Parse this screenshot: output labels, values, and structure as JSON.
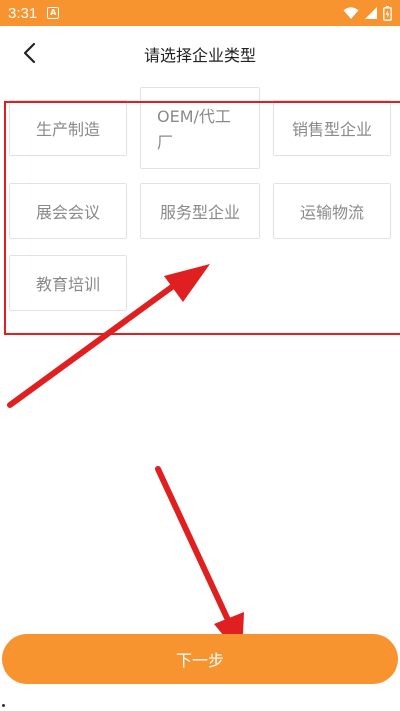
{
  "status_bar": {
    "time": "3:31",
    "notification_letter": "A",
    "icons": [
      "wifi-icon",
      "signal-icon",
      "battery-charging-icon"
    ],
    "background_color": "#f7942f"
  },
  "navbar": {
    "back_icon": "chevron-left-icon",
    "title": "请选择企业类型"
  },
  "enterprise_types": [
    "生产制造",
    "OEM/代工厂",
    "销售型企业",
    "展会会议",
    "服务型企业",
    "运输物流",
    "教育培训"
  ],
  "next_button": {
    "label": "下一步",
    "color": "#f7942f"
  },
  "annotations": {
    "highlight_color": "#e02020"
  }
}
